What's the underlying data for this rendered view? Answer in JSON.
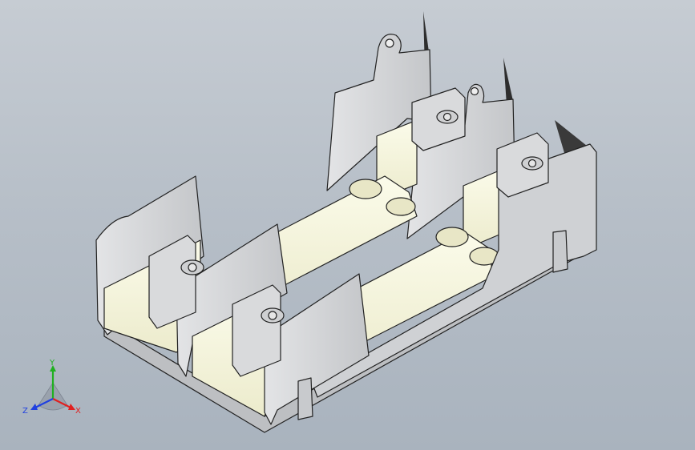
{
  "viewport": {
    "background_top": "#c6ccd3",
    "background_bottom": "#a9b3be"
  },
  "model": {
    "part_color": "#d6d7d9",
    "edge_color": "#222222",
    "insulator_color": "#f4f3dc"
  },
  "triad": {
    "x_label": "X",
    "y_label": "Y",
    "z_label": "Z",
    "x_color": "#e02020",
    "y_color": "#20b020",
    "z_color": "#2040e0"
  }
}
